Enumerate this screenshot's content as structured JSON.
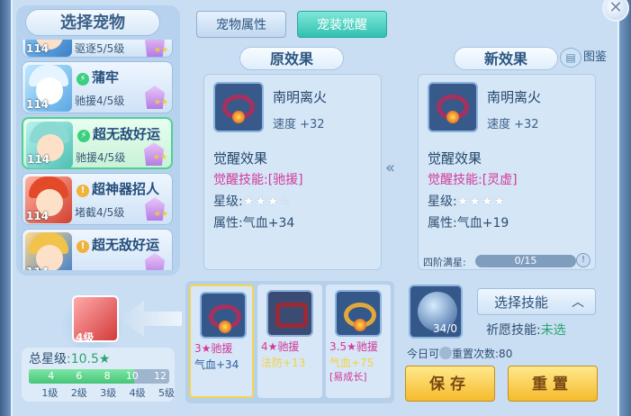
{
  "left": {
    "title": "选择宠物",
    "pets": [
      {
        "level": "114",
        "name": "",
        "sub": "驱逐5/5级",
        "badge": "",
        "partial": true
      },
      {
        "level": "114",
        "name": "蒲牢",
        "sub": "驰援4/5级",
        "badge": "green"
      },
      {
        "level": "114",
        "name": "超无敌好运",
        "sub": "驰援4/5级",
        "badge": "green",
        "selected": true
      },
      {
        "level": "114",
        "name": "超神器招人",
        "sub": "堵截4/5级",
        "badge": "gold"
      },
      {
        "level": "114",
        "name": "超无敌好运",
        "sub": "",
        "badge": "gold"
      }
    ],
    "current_level": "4级",
    "total_label": "总星级",
    "total_value": ":10.5★",
    "bar_fraction": 0.75,
    "bar_ticks": [
      "4",
      "6",
      "8",
      "10",
      "12"
    ],
    "level_labels": [
      "1级",
      "2级",
      "3级",
      "4级",
      "5级"
    ]
  },
  "tabs": {
    "attr": "宠物属性",
    "awaken": "宠装觉醒"
  },
  "orig": {
    "head": "原效果",
    "name": "南明离火",
    "stat": "速度 +32",
    "title": "觉醒效果",
    "skill_prefix": "觉醒技能:",
    "skill": "[驰援]",
    "star_label": "星级:",
    "stars": "★★★☆",
    "attr_label": "属性:",
    "attr": "气血+34"
  },
  "new": {
    "head": "新效果",
    "tujian": "图鉴",
    "name": "南明离火",
    "stat": "速度 +32",
    "title": "觉醒效果",
    "skill_prefix": "觉醒技能:",
    "skill": "[灵虚]",
    "star_label": "星级:",
    "stars": "★★★★",
    "attr_label": "属性:",
    "attr": "气血+19",
    "prog_label": "四阶满星:",
    "prog_value": "0/15"
  },
  "candidates": [
    {
      "l1": "3★驰援",
      "l2": "气血+34",
      "l3": ""
    },
    {
      "l1": "4★驰援",
      "l2": "法防+13",
      "l3": ""
    },
    {
      "l1": "3.5★驰援",
      "l2": "气血+75",
      "l3": "[易成长]"
    }
  ],
  "right": {
    "orb_count": "34/0",
    "select_skill": "选择技能",
    "pray_label": "祈愿技能:",
    "pray_value": "未选",
    "today": "今日可",
    "today2": "重置次数:80",
    "save": "保存",
    "reset": "重置"
  },
  "colors": {
    "accent": "#30c0b0",
    "pink": "#d23a9a",
    "gold": "#f5bb2c"
  }
}
